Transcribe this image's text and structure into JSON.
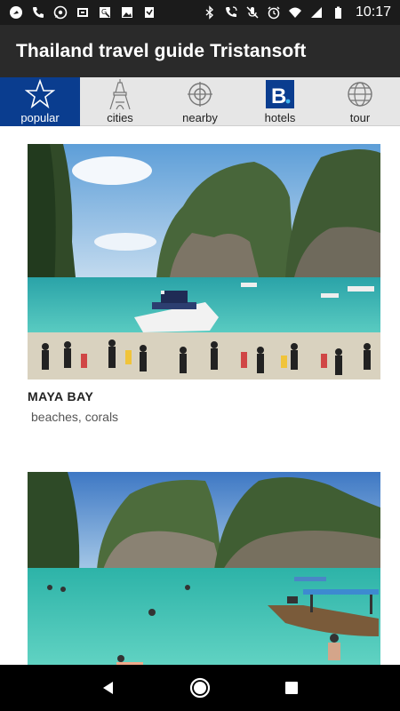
{
  "status_bar": {
    "time": "10:17",
    "left_icons": [
      "app-icon",
      "phone-icon",
      "whatsapp-icon",
      "notification-icon",
      "maps-icon",
      "image-icon",
      "download-icon"
    ],
    "right_icons": [
      "bluetooth-icon",
      "wifi-calling-icon",
      "mute-icon",
      "alarm-icon",
      "wifi-icon",
      "signal-icon",
      "battery-icon"
    ]
  },
  "app": {
    "title": "Thailand travel guide Tristansoft"
  },
  "tabs": [
    {
      "label": "popular",
      "icon": "star-icon",
      "active": true
    },
    {
      "label": "cities",
      "icon": "eiffel-tower-icon",
      "active": false
    },
    {
      "label": "nearby",
      "icon": "target-icon",
      "active": false
    },
    {
      "label": "hotels",
      "icon": "booking-icon",
      "active": false
    },
    {
      "label": "tour",
      "icon": "globe-icon",
      "active": false
    }
  ],
  "places": [
    {
      "name": "MAYA BAY",
      "tags": "beaches, corals"
    },
    {
      "name": "",
      "tags": ""
    }
  ],
  "colors": {
    "status_bar": "#1b1b1b",
    "app_bar": "#2a2a2a",
    "tab_bar": "#e6e6e6",
    "tab_active": "#0a3d8f",
    "booking_blue": "#0a3d8f"
  },
  "nav_bar": {
    "icons": [
      "back-icon",
      "home-icon",
      "recents-icon"
    ]
  }
}
